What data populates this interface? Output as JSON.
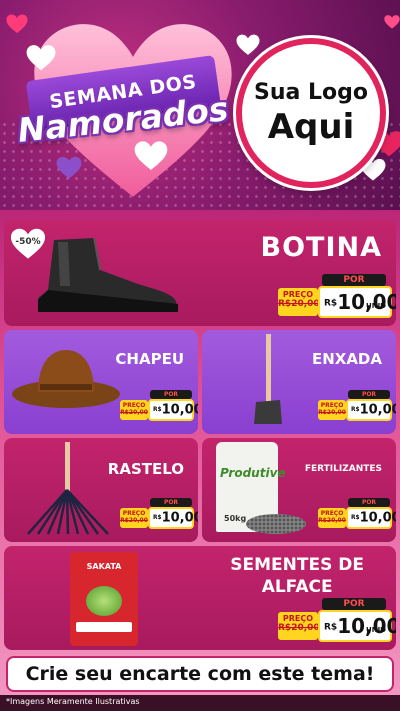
{
  "header": {
    "banner_line1": "SEMANA DOS",
    "banner_line2": "Namorados",
    "logo_line1": "Sua Logo",
    "logo_line2": "Aqui"
  },
  "products": [
    {
      "name": "BOTINA",
      "discount": "-50%",
      "preco_label": "PREÇO",
      "old_price": "R$20,00",
      "por_label": "POR",
      "currency": "R$",
      "price": "10,00",
      "unit": "UNID"
    },
    {
      "name": "CHAPEU",
      "preco_label": "PREÇO",
      "old_price": "R$20,00",
      "por_label": "POR",
      "currency": "R$",
      "price": "10,00"
    },
    {
      "name": "ENXADA",
      "preco_label": "PREÇO",
      "old_price": "R$20,00",
      "por_label": "POR",
      "currency": "R$",
      "price": "10,00"
    },
    {
      "name": "RASTELO",
      "preco_label": "PREÇO",
      "old_price": "R$20,00",
      "por_label": "POR",
      "currency": "R$",
      "price": "10,00"
    },
    {
      "name": "FERTILIZANTES",
      "preco_label": "PREÇO",
      "old_price": "R$20,00",
      "por_label": "POR",
      "currency": "R$",
      "price": "10,00",
      "bag_brand": "Produtive",
      "bag_weight": "50kg"
    },
    {
      "name_line1": "SEMENTES DE",
      "name_line2": "ALFACE",
      "preco_label": "PREÇO",
      "old_price": "R$20,00",
      "por_label": "POR",
      "currency": "R$",
      "price": "10,00",
      "unit": "UNID",
      "pack_brand": "SAKATA"
    }
  ],
  "cta": "Crie seu encarte com este tema!",
  "footer": "*Imagens Meramente Ilustrativas",
  "colors": {
    "pink_card": "#c3246c",
    "purple_card": "#9a52d9",
    "yellow": "#ffd51f",
    "red": "#c4161c"
  }
}
